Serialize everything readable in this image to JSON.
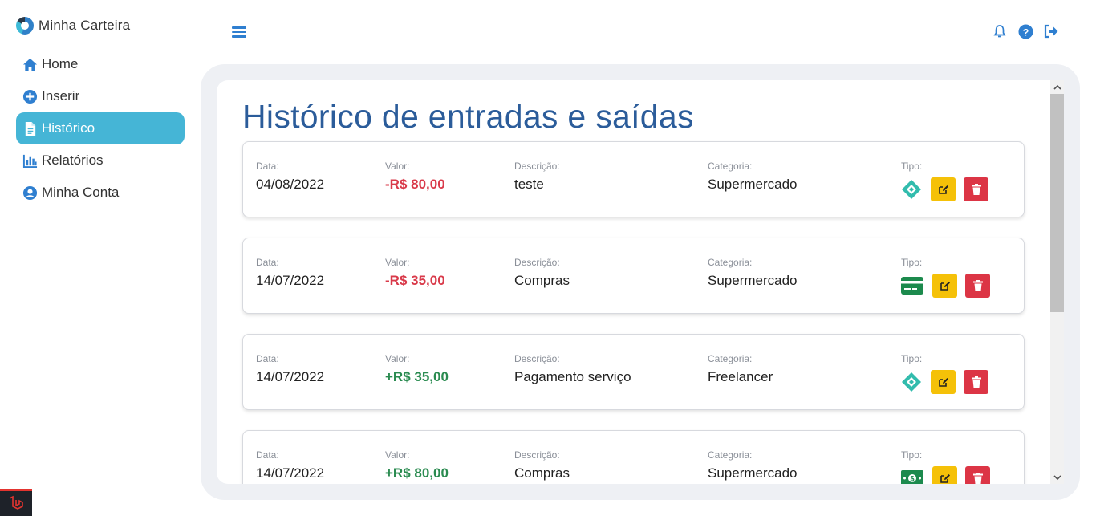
{
  "app": {
    "name": "Minha Carteira"
  },
  "sidebar": {
    "items": [
      {
        "label": "Home",
        "icon": "home-icon"
      },
      {
        "label": "Inserir",
        "icon": "plus-circle-icon"
      },
      {
        "label": "Histórico",
        "icon": "document-icon",
        "active": true
      },
      {
        "label": "Relatórios",
        "icon": "bar-chart-icon"
      },
      {
        "label": "Minha Conta",
        "icon": "user-circle-icon"
      }
    ]
  },
  "header": {
    "icons": [
      "menu-icon",
      "bell-icon",
      "help-icon",
      "logout-icon"
    ]
  },
  "main": {
    "title": "Histórico de entradas e saídas",
    "labels": {
      "date": "Data:",
      "value": "Valor:",
      "description": "Descrição:",
      "category": "Categoria:",
      "type": "Tipo:"
    },
    "transactions": [
      {
        "date": "04/08/2022",
        "value": "-R$ 80,00",
        "direction": "out",
        "description": "teste",
        "category": "Supermercado",
        "type_icon": "pix-icon"
      },
      {
        "date": "14/07/2022",
        "value": "-R$ 35,00",
        "direction": "out",
        "description": "Compras",
        "category": "Supermercado",
        "type_icon": "credit-card-icon"
      },
      {
        "date": "14/07/2022",
        "value": "+R$ 35,00",
        "direction": "in",
        "description": "Pagamento serviço",
        "category": "Freelancer",
        "type_icon": "pix-icon"
      },
      {
        "date": "14/07/2022",
        "value": "+R$ 80,00",
        "direction": "in",
        "description": "Compras",
        "category": "Supermercado",
        "type_icon": "cash-icon"
      }
    ]
  },
  "colors": {
    "accent": "#45b5d6",
    "title": "#2b5c9a",
    "negative": "#d93a4a",
    "positive": "#2a8b50",
    "edit": "#f5c108",
    "delete": "#dc3545"
  }
}
